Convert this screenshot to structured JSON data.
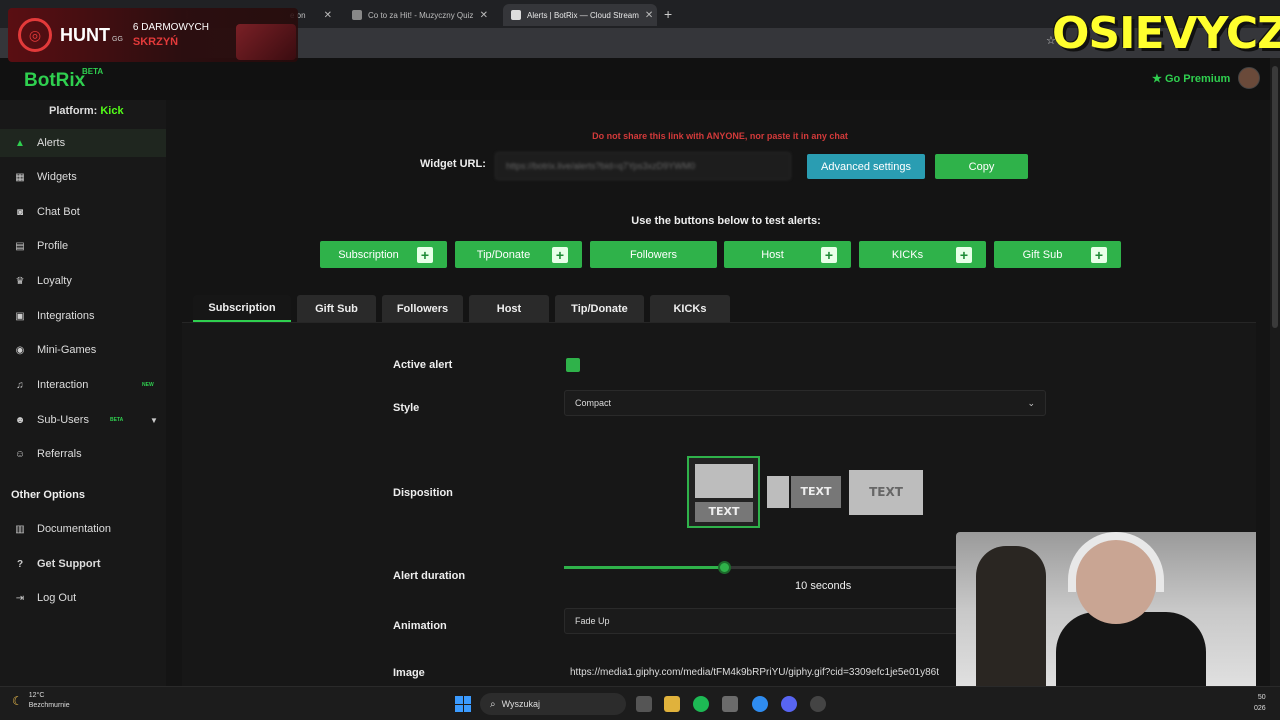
{
  "browser": {
    "tabs": [
      {
        "label": "Co to za Hit! - Muzyczny Quiz"
      },
      {
        "label": "Alerts | BotRix — Cloud Stream"
      }
    ],
    "partial_tab_suffix": "e on"
  },
  "overlays": {
    "hunt": {
      "name": "HUNT",
      "sub": "GG",
      "promo_line1": "6 DARMOWYCH",
      "promo_line2": "SKRZYŃ"
    },
    "streamer_name": "OSIEVYCZ"
  },
  "app": {
    "logo": "BotRix",
    "logo_badge": "BETA",
    "premium": "Go Premium",
    "premium_icon": "star-icon"
  },
  "sidebar": {
    "platform_label": "Platform:",
    "platform_value": "Kick",
    "items": [
      {
        "label": "Alerts",
        "icon": "warning-icon",
        "active": true
      },
      {
        "label": "Widgets",
        "icon": "widgets-icon"
      },
      {
        "label": "Chat Bot",
        "icon": "robot-icon"
      },
      {
        "label": "Profile",
        "icon": "profile-icon"
      },
      {
        "label": "Loyalty",
        "icon": "trophy-icon"
      },
      {
        "label": "Integrations",
        "icon": "integrations-icon"
      },
      {
        "label": "Mini-Games",
        "icon": "gamepad-icon"
      },
      {
        "label": "Interaction",
        "icon": "music-icon",
        "badge": "NEW"
      },
      {
        "label": "Sub-Users",
        "icon": "users-icon",
        "badge": "BETA"
      },
      {
        "label": "Referrals",
        "icon": "referrals-icon"
      }
    ],
    "other_title": "Other Options",
    "other_items": [
      {
        "label": "Documentation",
        "icon": "documentation-icon"
      },
      {
        "label": "Get Support",
        "icon": "support-icon"
      },
      {
        "label": "Log Out",
        "icon": "logout-icon"
      }
    ]
  },
  "main": {
    "warning": "Do not share this link with ANYONE, nor paste it in any chat",
    "widget_url_label": "Widget URL:",
    "widget_url_value": "https://botrix.live/alerts?bid=q7Yps3xzD9YWM0",
    "advanced_button": "Advanced settings",
    "copy_button": "Copy",
    "test_heading": "Use the buttons below to test alerts:",
    "test_buttons": [
      "Subscription",
      "Tip/Donate",
      "Followers",
      "Host",
      "KICKs",
      "Gift Sub"
    ],
    "tabs": [
      "Subscription",
      "Gift Sub",
      "Followers",
      "Host",
      "Tip/Donate",
      "KICKs"
    ],
    "form": {
      "active_label": "Active alert",
      "active_value": true,
      "style_label": "Style",
      "style_value": "Compact",
      "disposition_label": "Disposition",
      "disposition_text": "TEXT",
      "duration_label": "Alert duration",
      "duration_value": 10,
      "duration_max": 30,
      "duration_unit": "seconds",
      "animation_label": "Animation",
      "animation_value": "Fade Up",
      "image_label": "Image",
      "image_value": "https://media1.giphy.com/media/tFM4k9bRPriYU/giphy.gif?cid=3309efc1je5e01y86t"
    }
  },
  "taskbar": {
    "temp": "12°C",
    "weather": "Bezchmurnie",
    "search_placeholder": "Wyszukaj",
    "clock_line1": "50",
    "clock_line2": "026"
  },
  "colors": {
    "accent": "#2fb24a",
    "accent_text": "#2fcf4f",
    "danger": "#d23a3a",
    "info": "#2a9db2"
  }
}
